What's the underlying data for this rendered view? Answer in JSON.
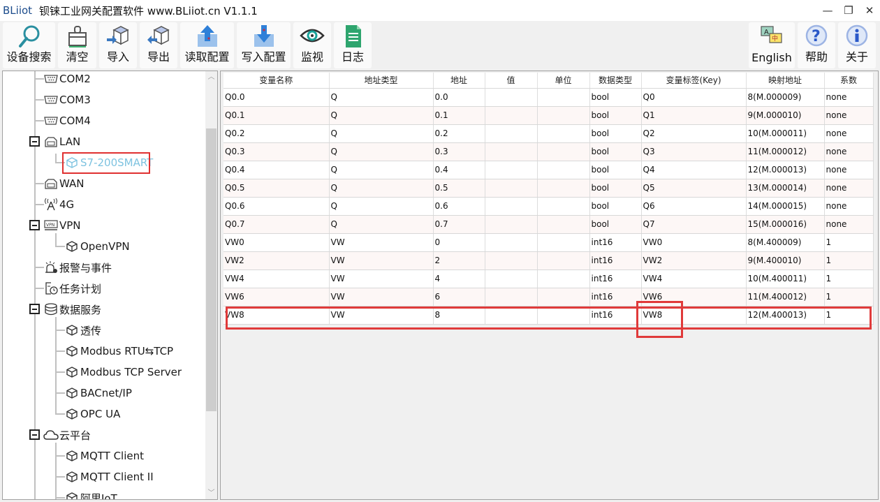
{
  "window": {
    "brand": "BLiiot",
    "title": "钡铼工业网关配置软件 www.BLiiot.cn V1.1.1",
    "controls": {
      "minimize": "—",
      "restore": "❐",
      "close": "✕"
    }
  },
  "toolbar": {
    "left": [
      {
        "id": "search",
        "label": "设备搜索",
        "icon": "search-icon"
      },
      {
        "id": "clear",
        "label": "清空",
        "icon": "broom-icon"
      },
      {
        "id": "import",
        "label": "导入",
        "icon": "import-box-icon"
      },
      {
        "id": "export",
        "label": "导出",
        "icon": "export-box-icon"
      },
      {
        "id": "read-config",
        "label": "读取配置",
        "icon": "upload-icon"
      },
      {
        "id": "write-config",
        "label": "写入配置",
        "icon": "download-icon"
      },
      {
        "id": "monitor",
        "label": "监视",
        "icon": "eye-icon"
      },
      {
        "id": "log",
        "label": "日志",
        "icon": "document-icon"
      }
    ],
    "right": [
      {
        "id": "english",
        "label": "English",
        "icon": "language-icon"
      },
      {
        "id": "help",
        "label": "帮助",
        "icon": "help-icon"
      },
      {
        "id": "about",
        "label": "关于",
        "icon": "info-icon"
      }
    ]
  },
  "tree": {
    "nodes": [
      {
        "label": "COM2",
        "icon": "serial-port-icon",
        "level": 1
      },
      {
        "label": "COM3",
        "icon": "serial-port-icon",
        "level": 1
      },
      {
        "label": "COM4",
        "icon": "serial-port-icon",
        "level": 1
      },
      {
        "label": "LAN",
        "icon": "ethernet-icon",
        "level": 1,
        "expanded": true
      },
      {
        "label": "S7-200SMART",
        "icon": "cube-icon",
        "level": 2,
        "selected": true
      },
      {
        "label": "WAN",
        "icon": "ethernet-icon",
        "level": 1
      },
      {
        "label": "4G",
        "icon": "antenna-icon",
        "level": 1
      },
      {
        "label": "VPN",
        "icon": "vpn-icon",
        "level": 1,
        "expanded": true
      },
      {
        "label": "OpenVPN",
        "icon": "cube-icon",
        "level": 2
      },
      {
        "label": "报警与事件",
        "icon": "alarm-icon",
        "level": 1
      },
      {
        "label": "任务计划",
        "icon": "schedule-icon",
        "level": 1
      },
      {
        "label": "数据服务",
        "icon": "database-icon",
        "level": 1,
        "expanded": true
      },
      {
        "label": "透传",
        "icon": "cube-icon",
        "level": 2
      },
      {
        "label": "Modbus RTU⇆TCP",
        "icon": "cube-icon",
        "level": 2
      },
      {
        "label": "Modbus TCP Server",
        "icon": "cube-icon",
        "level": 2
      },
      {
        "label": "BACnet/IP",
        "icon": "cube-icon",
        "level": 2
      },
      {
        "label": "OPC UA",
        "icon": "cube-icon",
        "level": 2
      },
      {
        "label": "云平台",
        "icon": "cloud-icon",
        "level": 1,
        "expanded": true
      },
      {
        "label": "MQTT Client",
        "icon": "cube-icon",
        "level": 2
      },
      {
        "label": "MQTT Client II",
        "icon": "cube-icon",
        "level": 2
      },
      {
        "label": "阿里IoT",
        "icon": "cube-icon",
        "level": 2
      }
    ]
  },
  "grid": {
    "columns": [
      "变量名称",
      "地址类型",
      "地址",
      "值",
      "单位",
      "数据类型",
      "变量标签(Key)",
      "映射地址",
      "系数"
    ],
    "rows": [
      [
        "Q0.0",
        "Q",
        "0.0",
        "",
        "",
        "bool",
        "Q0",
        "8(M.000009)",
        "none"
      ],
      [
        "Q0.1",
        "Q",
        "0.1",
        "",
        "",
        "bool",
        "Q1",
        "9(M.000010)",
        "none"
      ],
      [
        "Q0.2",
        "Q",
        "0.2",
        "",
        "",
        "bool",
        "Q2",
        "10(M.000011)",
        "none"
      ],
      [
        "Q0.3",
        "Q",
        "0.3",
        "",
        "",
        "bool",
        "Q3",
        "11(M.000012)",
        "none"
      ],
      [
        "Q0.4",
        "Q",
        "0.4",
        "",
        "",
        "bool",
        "Q4",
        "12(M.000013)",
        "none"
      ],
      [
        "Q0.5",
        "Q",
        "0.5",
        "",
        "",
        "bool",
        "Q5",
        "13(M.000014)",
        "none"
      ],
      [
        "Q0.6",
        "Q",
        "0.6",
        "",
        "",
        "bool",
        "Q6",
        "14(M.000015)",
        "none"
      ],
      [
        "Q0.7",
        "Q",
        "0.7",
        "",
        "",
        "bool",
        "Q7",
        "15(M.000016)",
        "none"
      ],
      [
        "VW0",
        "VW",
        "0",
        "",
        "",
        "int16",
        "VW0",
        "8(M.400009)",
        "1"
      ],
      [
        "VW2",
        "VW",
        "2",
        "",
        "",
        "int16",
        "VW2",
        "9(M.400010)",
        "1"
      ],
      [
        "VW4",
        "VW",
        "4",
        "",
        "",
        "int16",
        "VW4",
        "10(M.400011)",
        "1"
      ],
      [
        "VW6",
        "VW",
        "6",
        "",
        "",
        "int16",
        "VW6",
        "11(M.400012)",
        "1"
      ],
      [
        "VW8",
        "VW",
        "8",
        "",
        "",
        "int16",
        "VW8",
        "12(M.400013)",
        "1"
      ]
    ],
    "highlighted_row": 12,
    "highlight_color": "#e03a3a"
  }
}
